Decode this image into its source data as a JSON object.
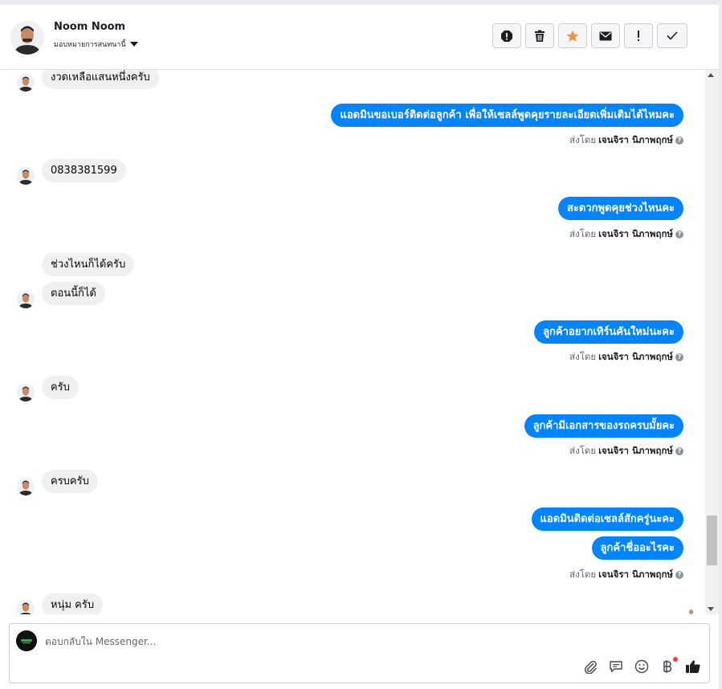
{
  "header": {
    "name": "Noom Noom",
    "assign_label": "มอบหมายการสนทนานี้",
    "actions": [
      {
        "icon": "alert-icon",
        "name": "mark-spam-button"
      },
      {
        "icon": "trash-icon",
        "name": "delete-button"
      },
      {
        "icon": "star-icon",
        "name": "star-button"
      },
      {
        "icon": "envelope-icon",
        "name": "mark-unread-button"
      },
      {
        "icon": "exclamation-icon",
        "name": "follow-up-button"
      },
      {
        "icon": "check-icon",
        "name": "mark-done-button"
      }
    ]
  },
  "colors": {
    "outgoing": "#0084ff",
    "incoming": "#f1f0f0",
    "star": "#f7923a"
  },
  "messages": [
    {
      "dir": "in",
      "text": "งวดเหลือแสนหนึ่งครับ"
    },
    {
      "dir": "out",
      "text": "แอดมินขอเบอร์ติดต่อลูกค้า เพื่อให้เซลล์พูดคุยรายละเอียดเพิ่มเติมได้ไหมคะ"
    },
    {
      "dir": "in",
      "text": "0838381599"
    },
    {
      "dir": "out",
      "text": "สะดวกพูดคุยช่วงไหนคะ"
    },
    {
      "dir": "in",
      "text": "ช่วงไหนก็ได้ครับ"
    },
    {
      "dir": "in",
      "text": "ตอนนี้ก็ได้"
    },
    {
      "dir": "out",
      "text": "ลูกค้าอยากเทิร์นคันใหม่นะคะ"
    },
    {
      "dir": "in",
      "text": "ครับ"
    },
    {
      "dir": "out",
      "text": "ลูกค้ามีเอกสารของรถครบมั้ยคะ"
    },
    {
      "dir": "in",
      "text": "ครบครับ"
    },
    {
      "dir": "out",
      "text": "แอดมินติดต่อเซลล์สักครู่นะคะ"
    },
    {
      "dir": "out",
      "text": "ลูกค้าชื่ออะไรคะ"
    },
    {
      "dir": "in",
      "text": "หนุ่ม ครับ"
    }
  ],
  "sent_by": {
    "prefix": "ส่งโดย",
    "agent": "เจนจิรา นิภาพฤกษ์"
  },
  "composer": {
    "placeholder": "ตอบกลับใน Messenger...",
    "tools": [
      "paperclip-icon",
      "saved-reply-icon",
      "emoji-icon",
      "baht-payment-icon",
      "thumbs-up-icon"
    ]
  }
}
